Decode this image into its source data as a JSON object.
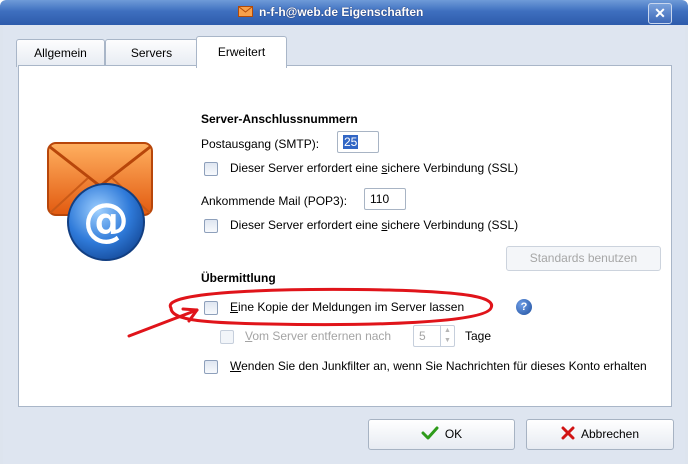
{
  "window": {
    "title": "n-f-h@web.de Eigenschaften",
    "close_symbol": "✕"
  },
  "tabs": [
    {
      "label": "Allgemein",
      "active": false
    },
    {
      "label": "Servers",
      "active": false
    },
    {
      "label": "Erweitert",
      "active": true
    }
  ],
  "ports": {
    "heading": "Server-Anschlussnummern",
    "smtp_label": "Postausgang (SMTP):",
    "smtp_value": "25",
    "smtp_ssl_pre": "Dieser Server erfordert eine ",
    "smtp_ssl_key": "s",
    "smtp_ssl_post": "ichere Verbindung (SSL)",
    "pop3_label": "Ankommende Mail (POP3):",
    "pop3_value": "110",
    "pop3_ssl_pre": "Dieser Server erfordert eine ",
    "pop3_ssl_key": "s",
    "pop3_ssl_post": "ichere Verbindung (SSL)",
    "defaults_button": "Standards benutzen"
  },
  "delivery": {
    "heading": "Übermittlung",
    "keep_copy_key": "E",
    "keep_copy_rest": "ine Kopie der Meldungen im Server lassen",
    "help_symbol": "?",
    "remove_key": "V",
    "remove_rest": "om Server entfernen nach",
    "days_value": "5",
    "days_label": "Tage",
    "junk_key": "W",
    "junk_rest": "enden Sie den Junkfilter an, wenn Sie Nachrichten für dieses Konto erhalten"
  },
  "buttons": {
    "ok": "OK",
    "cancel": "Abbrechen"
  },
  "annotation": {
    "color": "#e0141a"
  },
  "icons": [
    "envelope-icon",
    "at-sign-icon",
    "help-icon",
    "checkmark-icon",
    "cross-icon",
    "close-icon"
  ]
}
